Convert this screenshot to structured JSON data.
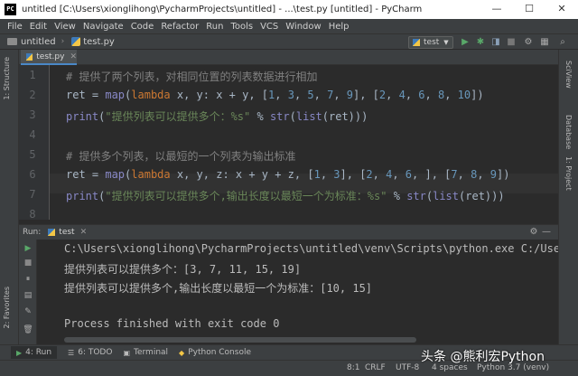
{
  "window": {
    "title": "untitled [C:\\Users\\xionglihong\\PycharmProjects\\untitled] - ...\\test.py [untitled] - PyCharm",
    "app_icon_text": "PC",
    "controls": [
      "—",
      "☐",
      "✕"
    ]
  },
  "menu": [
    "File",
    "Edit",
    "View",
    "Navigate",
    "Code",
    "Refactor",
    "Run",
    "Tools",
    "VCS",
    "Window",
    "Help"
  ],
  "nav": {
    "project": "untitled",
    "file": "test.py",
    "run_config": "test"
  },
  "side_tabs": {
    "left_top": "1: Structure",
    "left_bottom": "2: Favorites",
    "right_top": "SciView",
    "right_mid": "Database",
    "right_bottom": "1: Project"
  },
  "editor": {
    "tab_label": "test.py",
    "line_numbers": [
      "1",
      "2",
      "3",
      "4",
      "5",
      "6",
      "7",
      "8"
    ],
    "lines": [
      [
        {
          "t": "# 提供了两个列表，对相同位置的列表数据进行相加",
          "c": "c-com"
        }
      ],
      [
        {
          "t": "ret = ",
          "c": ""
        },
        {
          "t": "map",
          "c": "c-bi"
        },
        {
          "t": "(",
          "c": ""
        },
        {
          "t": "lambda",
          "c": "c-kw"
        },
        {
          "t": " x, y: x + y, [",
          "c": ""
        },
        {
          "t": "1",
          "c": "c-num"
        },
        {
          "t": ", ",
          "c": ""
        },
        {
          "t": "3",
          "c": "c-num"
        },
        {
          "t": ", ",
          "c": ""
        },
        {
          "t": "5",
          "c": "c-num"
        },
        {
          "t": ", ",
          "c": ""
        },
        {
          "t": "7",
          "c": "c-num"
        },
        {
          "t": ", ",
          "c": ""
        },
        {
          "t": "9",
          "c": "c-num"
        },
        {
          "t": "], [",
          "c": ""
        },
        {
          "t": "2",
          "c": "c-num"
        },
        {
          "t": ", ",
          "c": ""
        },
        {
          "t": "4",
          "c": "c-num"
        },
        {
          "t": ", ",
          "c": ""
        },
        {
          "t": "6",
          "c": "c-num"
        },
        {
          "t": ", ",
          "c": ""
        },
        {
          "t": "8",
          "c": "c-num"
        },
        {
          "t": ", ",
          "c": ""
        },
        {
          "t": "10",
          "c": "c-num"
        },
        {
          "t": "])",
          "c": ""
        }
      ],
      [
        {
          "t": "print",
          "c": "c-bi"
        },
        {
          "t": "(",
          "c": ""
        },
        {
          "t": "\"提供列表可以提供多个：%s\"",
          "c": "c-str"
        },
        {
          "t": " % ",
          "c": ""
        },
        {
          "t": "str",
          "c": "c-bi"
        },
        {
          "t": "(",
          "c": ""
        },
        {
          "t": "list",
          "c": "c-bi"
        },
        {
          "t": "(ret)))",
          "c": ""
        }
      ],
      [],
      [
        {
          "t": "# 提供多个列表，以最短的一个列表为输出标准",
          "c": "c-com"
        }
      ],
      [
        {
          "t": "ret = ",
          "c": ""
        },
        {
          "t": "map",
          "c": "c-bi"
        },
        {
          "t": "(",
          "c": ""
        },
        {
          "t": "lambda",
          "c": "c-kw"
        },
        {
          "t": " x, y, z: x + y + z, [",
          "c": ""
        },
        {
          "t": "1",
          "c": "c-num"
        },
        {
          "t": ", ",
          "c": ""
        },
        {
          "t": "3",
          "c": "c-num"
        },
        {
          "t": "], [",
          "c": ""
        },
        {
          "t": "2",
          "c": "c-num"
        },
        {
          "t": ", ",
          "c": ""
        },
        {
          "t": "4",
          "c": "c-num"
        },
        {
          "t": ", ",
          "c": ""
        },
        {
          "t": "6",
          "c": "c-num"
        },
        {
          "t": ", ], [",
          "c": ""
        },
        {
          "t": "7",
          "c": "c-num"
        },
        {
          "t": ", ",
          "c": ""
        },
        {
          "t": "8",
          "c": "c-num"
        },
        {
          "t": ", ",
          "c": ""
        },
        {
          "t": "9",
          "c": "c-num"
        },
        {
          "t": "])",
          "c": ""
        }
      ],
      [
        {
          "t": "print",
          "c": "c-bi"
        },
        {
          "t": "(",
          "c": ""
        },
        {
          "t": "\"提供列表可以提供多个,输出长度以最短一个为标准：%s\"",
          "c": "c-str"
        },
        {
          "t": " % ",
          "c": ""
        },
        {
          "t": "str",
          "c": "c-bi"
        },
        {
          "t": "(",
          "c": ""
        },
        {
          "t": "list",
          "c": "c-bi"
        },
        {
          "t": "(ret)))",
          "c": ""
        }
      ],
      []
    ]
  },
  "run": {
    "label": "Run:",
    "tab_label": "test",
    "console": [
      "C:\\Users\\xionglihong\\PycharmProjects\\untitled\\venv\\Scripts\\python.exe C:/Users/xi",
      "提供列表可以提供多个：[3, 7, 11, 15, 19]",
      "提供列表可以提供多个,输出长度以最短一个为标准：[10, 15]",
      "",
      "Process finished with exit code 0"
    ]
  },
  "bottom_tabs": [
    {
      "icon": "▶",
      "label": "4: Run"
    },
    {
      "icon": "☰",
      "label": "6: TODO"
    },
    {
      "icon": "▣",
      "label": "Terminal"
    },
    {
      "icon": "◆",
      "label": "Python Console"
    }
  ],
  "status": {
    "position": "8:1",
    "line_sep": "CRLF",
    "encoding": "UTF-8",
    "indent": "4 spaces",
    "interpreter": "Python 3.7 (venv)"
  },
  "watermark": "头条 @熊利宏Python",
  "colors": {
    "accent": "#4a88c7",
    "run_green": "#59a869",
    "stop_red": "#c75450"
  }
}
